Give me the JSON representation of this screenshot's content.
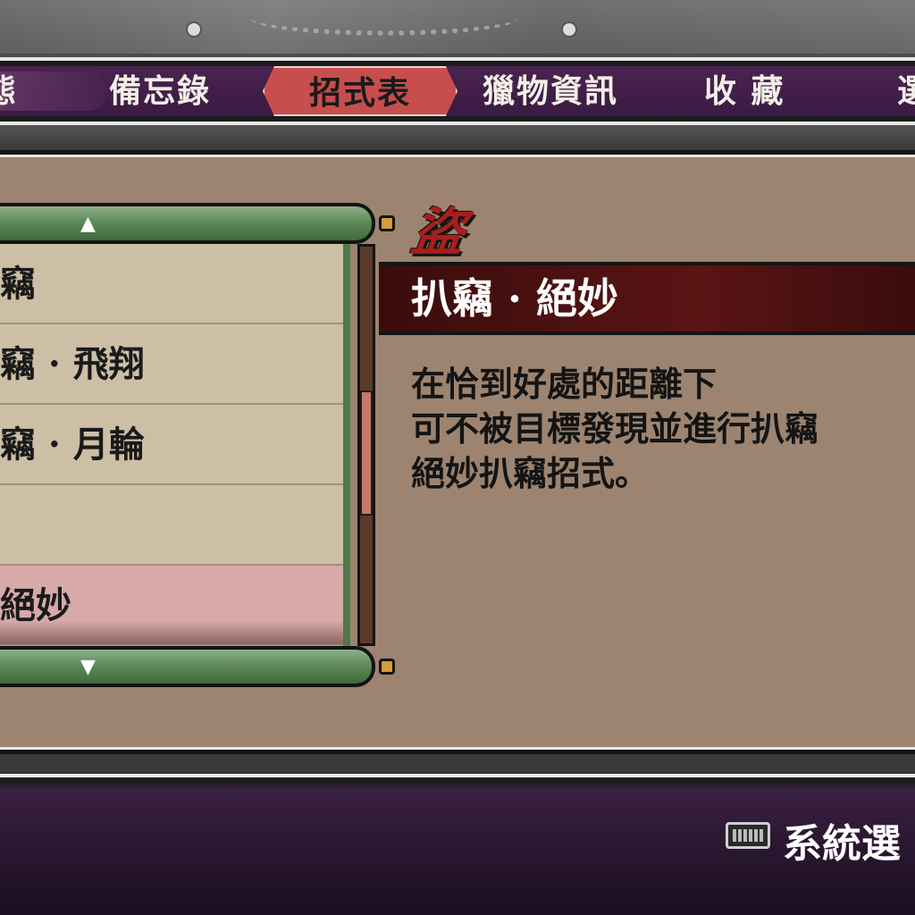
{
  "tabs": {
    "partial_left": "態",
    "memo": "備忘錄",
    "move_list": "招式表",
    "prey_info": "獵物資訊",
    "collection": "收 藏",
    "partial_right": "選"
  },
  "move_list": {
    "up_arrow": "▲",
    "down_arrow": "▼",
    "items": [
      {
        "label": "竊"
      },
      {
        "label": "竊 · 飛翔"
      },
      {
        "label": "竊 · 月輪"
      },
      {
        "label": ""
      },
      {
        "label": "絕妙"
      }
    ]
  },
  "detail": {
    "category_glyph": "盜",
    "title": "扒竊 · 絕妙",
    "description": "在恰到好處的距離下\n可不被目標發現並進行扒竊\n絕妙扒竊招式。"
  },
  "footer": {
    "system_options_label": "系統選"
  },
  "colors": {
    "tab_active": "#c84e4e",
    "tab_bar": "#4a2350",
    "panel": "#9c8470",
    "scroll_rod": "#5f8a5a",
    "title_bar": "#5a1414",
    "selected_row": "#d8a9a9"
  }
}
